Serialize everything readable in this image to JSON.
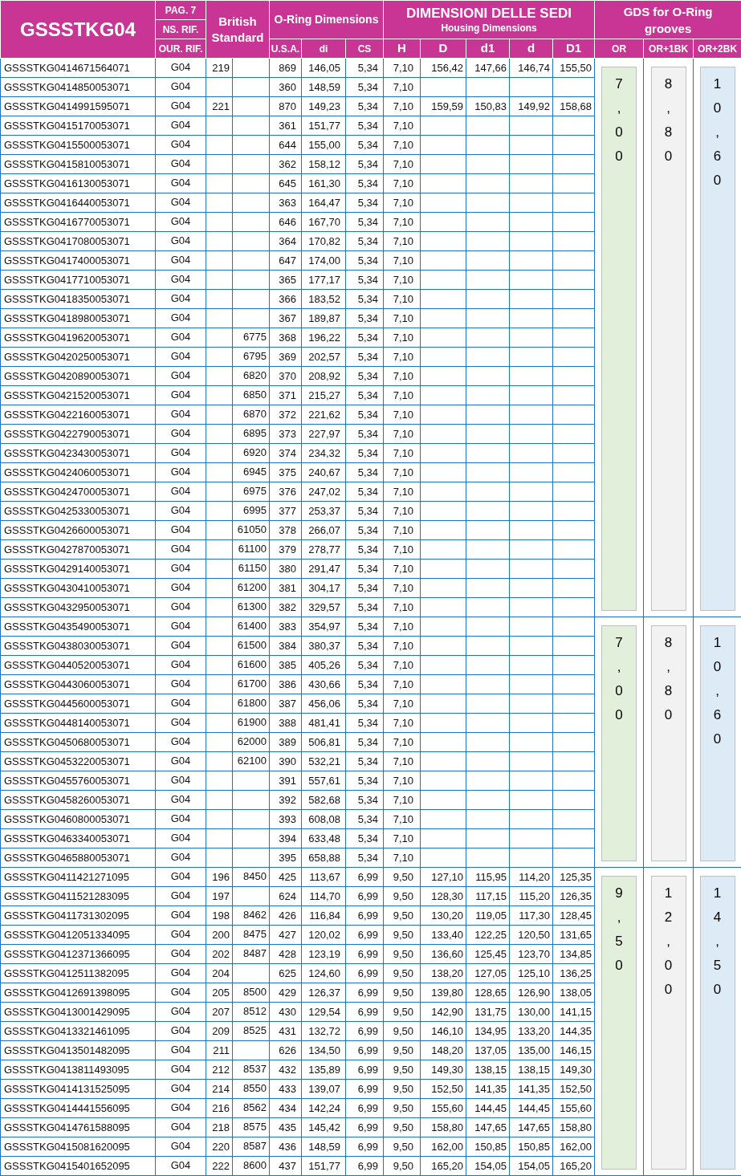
{
  "header": {
    "title": "GSSSTKG04",
    "page": "PAG. 7",
    "ns_ref": "NS. RIF.",
    "our_ref": "OUR. RIF.",
    "british_standard": "British Standard",
    "oring_dimensions": {
      "title": "O-Ring Dimensions",
      "columns": [
        "U.S.A.",
        "di",
        "CS"
      ]
    },
    "housing": {
      "title": "DIMENSIONI DELLE SEDI",
      "subtitle": "Housing Dimensions",
      "columns": [
        "H",
        "D",
        "d1",
        "d",
        "D1"
      ]
    },
    "gds": {
      "title": "GDS for O-Ring grooves",
      "columns": [
        "OR",
        "OR+1BK",
        "OR+2BK"
      ]
    }
  },
  "groups": [
    {
      "or": "7,00",
      "or_1bk": "8,80",
      "or_2bk": "10,60",
      "rows": [
        {
          "code": "GSSSTKG0414671564071",
          "ref": "G04",
          "bs": "219",
          "usa": "869",
          "di": "146,05",
          "cs": "5,34",
          "H": "7,10",
          "D": "156,42",
          "d1": "147,66",
          "d": "146,74",
          "D1": "155,50"
        },
        {
          "code": "GSSSTKG0414850053071",
          "ref": "G04",
          "usa": "360",
          "di": "148,59",
          "cs": "5,34",
          "H": "7,10"
        },
        {
          "code": "GSSSTKG0414991595071",
          "ref": "G04",
          "bs": "221",
          "usa": "870",
          "di": "149,23",
          "cs": "5,34",
          "H": "7,10",
          "D": "159,59",
          "d1": "150,83",
          "d": "149,92",
          "D1": "158,68"
        },
        {
          "code": "GSSSTKG0415170053071",
          "ref": "G04",
          "usa": "361",
          "di": "151,77",
          "cs": "5,34",
          "H": "7,10"
        },
        {
          "code": "GSSSTKG0415500053071",
          "ref": "G04",
          "usa": "644",
          "di": "155,00",
          "cs": "5,34",
          "H": "7,10"
        },
        {
          "code": "GSSSTKG0415810053071",
          "ref": "G04",
          "usa": "362",
          "di": "158,12",
          "cs": "5,34",
          "H": "7,10"
        },
        {
          "code": "GSSSTKG0416130053071",
          "ref": "G04",
          "usa": "645",
          "di": "161,30",
          "cs": "5,34",
          "H": "7,10"
        },
        {
          "code": "GSSSTKG0416440053071",
          "ref": "G04",
          "usa": "363",
          "di": "164,47",
          "cs": "5,34",
          "H": "7,10"
        },
        {
          "code": "GSSSTKG0416770053071",
          "ref": "G04",
          "usa": "646",
          "di": "167,70",
          "cs": "5,34",
          "H": "7,10"
        },
        {
          "code": "GSSSTKG0417080053071",
          "ref": "G04",
          "usa": "364",
          "di": "170,82",
          "cs": "5,34",
          "H": "7,10"
        },
        {
          "code": "GSSSTKG0417400053071",
          "ref": "G04",
          "usa": "647",
          "di": "174,00",
          "cs": "5,34",
          "H": "7,10"
        },
        {
          "code": "GSSSTKG0417710053071",
          "ref": "G04",
          "usa": "365",
          "di": "177,17",
          "cs": "5,34",
          "H": "7,10"
        },
        {
          "code": "GSSSTKG0418350053071",
          "ref": "G04",
          "usa": "366",
          "di": "183,52",
          "cs": "5,34",
          "H": "7,10"
        },
        {
          "code": "GSSSTKG0418980053071",
          "ref": "G04",
          "usa": "367",
          "di": "189,87",
          "cs": "5,34",
          "H": "7,10"
        },
        {
          "code": "GSSSTKG0419620053071",
          "ref": "G04",
          "bs2": "6775",
          "usa": "368",
          "di": "196,22",
          "cs": "5,34",
          "H": "7,10"
        },
        {
          "code": "GSSSTKG0420250053071",
          "ref": "G04",
          "bs2": "6795",
          "usa": "369",
          "di": "202,57",
          "cs": "5,34",
          "H": "7,10"
        },
        {
          "code": "GSSSTKG0420890053071",
          "ref": "G04",
          "bs2": "6820",
          "usa": "370",
          "di": "208,92",
          "cs": "5,34",
          "H": "7,10"
        },
        {
          "code": "GSSSTKG0421520053071",
          "ref": "G04",
          "bs2": "6850",
          "usa": "371",
          "di": "215,27",
          "cs": "5,34",
          "H": "7,10"
        },
        {
          "code": "GSSSTKG0422160053071",
          "ref": "G04",
          "bs2": "6870",
          "usa": "372",
          "di": "221,62",
          "cs": "5,34",
          "H": "7,10"
        },
        {
          "code": "GSSSTKG0422790053071",
          "ref": "G04",
          "bs2": "6895",
          "usa": "373",
          "di": "227,97",
          "cs": "5,34",
          "H": "7,10"
        },
        {
          "code": "GSSSTKG0423430053071",
          "ref": "G04",
          "bs2": "6920",
          "usa": "374",
          "di": "234,32",
          "cs": "5,34",
          "H": "7,10"
        },
        {
          "code": "GSSSTKG0424060053071",
          "ref": "G04",
          "bs2": "6945",
          "usa": "375",
          "di": "240,67",
          "cs": "5,34",
          "H": "7,10"
        },
        {
          "code": "GSSSTKG0424700053071",
          "ref": "G04",
          "bs2": "6975",
          "usa": "376",
          "di": "247,02",
          "cs": "5,34",
          "H": "7,10"
        },
        {
          "code": "GSSSTKG0425330053071",
          "ref": "G04",
          "bs2": "6995",
          "usa": "377",
          "di": "253,37",
          "cs": "5,34",
          "H": "7,10"
        },
        {
          "code": "GSSSTKG0426600053071",
          "ref": "G04",
          "bs2": "61050",
          "usa": "378",
          "di": "266,07",
          "cs": "5,34",
          "H": "7,10"
        },
        {
          "code": "GSSSTKG0427870053071",
          "ref": "G04",
          "bs2": "61100",
          "usa": "379",
          "di": "278,77",
          "cs": "5,34",
          "H": "7,10"
        },
        {
          "code": "GSSSTKG0429140053071",
          "ref": "G04",
          "bs2": "61150",
          "usa": "380",
          "di": "291,47",
          "cs": "5,34",
          "H": "7,10"
        },
        {
          "code": "GSSSTKG0430410053071",
          "ref": "G04",
          "bs2": "61200",
          "usa": "381",
          "di": "304,17",
          "cs": "5,34",
          "H": "7,10"
        },
        {
          "code": "GSSSTKG0432950053071",
          "ref": "G04",
          "bs2": "61300",
          "usa": "382",
          "di": "329,57",
          "cs": "5,34",
          "H": "7,10"
        }
      ]
    },
    {
      "or": "7,00",
      "or_1bk": "8,80",
      "or_2bk": "10,60",
      "rows": [
        {
          "code": "GSSSTKG0435490053071",
          "ref": "G04",
          "bs2": "61400",
          "usa": "383",
          "di": "354,97",
          "cs": "5,34",
          "H": "7,10"
        },
        {
          "code": "GSSSTKG0438030053071",
          "ref": "G04",
          "bs2": "61500",
          "usa": "384",
          "di": "380,37",
          "cs": "5,34",
          "H": "7,10"
        },
        {
          "code": "GSSSTKG0440520053071",
          "ref": "G04",
          "bs2": "61600",
          "usa": "385",
          "di": "405,26",
          "cs": "5,34",
          "H": "7,10"
        },
        {
          "code": "GSSSTKG0443060053071",
          "ref": "G04",
          "bs2": "61700",
          "usa": "386",
          "di": "430,66",
          "cs": "5,34",
          "H": "7,10"
        },
        {
          "code": "GSSSTKG0445600053071",
          "ref": "G04",
          "bs2": "61800",
          "usa": "387",
          "di": "456,06",
          "cs": "5,34",
          "H": "7,10"
        },
        {
          "code": "GSSSTKG0448140053071",
          "ref": "G04",
          "bs2": "61900",
          "usa": "388",
          "di": "481,41",
          "cs": "5,34",
          "H": "7,10"
        },
        {
          "code": "GSSSTKG0450680053071",
          "ref": "G04",
          "bs2": "62000",
          "usa": "389",
          "di": "506,81",
          "cs": "5,34",
          "H": "7,10"
        },
        {
          "code": "GSSSTKG0453220053071",
          "ref": "G04",
          "bs2": "62100",
          "usa": "390",
          "di": "532,21",
          "cs": "5,34",
          "H": "7,10"
        },
        {
          "code": "GSSSTKG0455760053071",
          "ref": "G04",
          "usa": "391",
          "di": "557,61",
          "cs": "5,34",
          "H": "7,10"
        },
        {
          "code": "GSSSTKG0458260053071",
          "ref": "G04",
          "usa": "392",
          "di": "582,68",
          "cs": "5,34",
          "H": "7,10"
        },
        {
          "code": "GSSSTKG0460800053071",
          "ref": "G04",
          "usa": "393",
          "di": "608,08",
          "cs": "5,34",
          "H": "7,10"
        },
        {
          "code": "GSSSTKG0463340053071",
          "ref": "G04",
          "usa": "394",
          "di": "633,48",
          "cs": "5,34",
          "H": "7,10"
        },
        {
          "code": "GSSSTKG0465880053071",
          "ref": "G04",
          "usa": "395",
          "di": "658,88",
          "cs": "5,34",
          "H": "7,10"
        }
      ]
    },
    {
      "or": "9,50",
      "or_1bk": "12,00",
      "or_2bk": "14,50",
      "rows": [
        {
          "code": "GSSSTKG0411421271095",
          "ref": "G04",
          "bs": "196",
          "bs2": "8450",
          "usa": "425",
          "di": "113,67",
          "cs": "6,99",
          "H": "9,50",
          "D": "127,10",
          "d1": "115,95",
          "d": "114,20",
          "D1": "125,35"
        },
        {
          "code": "GSSSTKG0411521283095",
          "ref": "G04",
          "bs": "197",
          "usa": "624",
          "di": "114,70",
          "cs": "6,99",
          "H": "9,50",
          "D": "128,30",
          "d1": "117,15",
          "d": "115,20",
          "D1": "126,35"
        },
        {
          "code": "GSSSTKG0411731302095",
          "ref": "G04",
          "bs": "198",
          "bs2": "8462",
          "usa": "426",
          "di": "116,84",
          "cs": "6,99",
          "H": "9,50",
          "D": "130,20",
          "d1": "119,05",
          "d": "117,30",
          "D1": "128,45"
        },
        {
          "code": "GSSSTKG0412051334095",
          "ref": "G04",
          "bs": "200",
          "bs2": "8475",
          "usa": "427",
          "di": "120,02",
          "cs": "6,99",
          "H": "9,50",
          "D": "133,40",
          "d1": "122,25",
          "d": "120,50",
          "D1": "131,65"
        },
        {
          "code": "GSSSTKG0412371366095",
          "ref": "G04",
          "bs": "202",
          "bs2": "8487",
          "usa": "428",
          "di": "123,19",
          "cs": "6,99",
          "H": "9,50",
          "D": "136,60",
          "d1": "125,45",
          "d": "123,70",
          "D1": "134,85"
        },
        {
          "code": "GSSSTKG0412511382095",
          "ref": "G04",
          "bs": "204",
          "usa": "625",
          "di": "124,60",
          "cs": "6,99",
          "H": "9,50",
          "D": "138,20",
          "d1": "127,05",
          "d": "125,10",
          "D1": "136,25"
        },
        {
          "code": "GSSSTKG0412691398095",
          "ref": "G04",
          "bs": "205",
          "bs2": "8500",
          "usa": "429",
          "di": "126,37",
          "cs": "6,99",
          "H": "9,50",
          "D": "139,80",
          "d1": "128,65",
          "d": "126,90",
          "D1": "138,05"
        },
        {
          "code": "GSSSTKG0413001429095",
          "ref": "G04",
          "bs": "207",
          "bs2": "8512",
          "usa": "430",
          "di": "129,54",
          "cs": "6,99",
          "H": "9,50",
          "D": "142,90",
          "d1": "131,75",
          "d": "130,00",
          "D1": "141,15"
        },
        {
          "code": "GSSSTKG0413321461095",
          "ref": "G04",
          "bs": "209",
          "bs2": "8525",
          "usa": "431",
          "di": "132,72",
          "cs": "6,99",
          "H": "9,50",
          "D": "146,10",
          "d1": "134,95",
          "d": "133,20",
          "D1": "144,35"
        },
        {
          "code": "GSSSTKG0413501482095",
          "ref": "G04",
          "bs": "211",
          "usa": "626",
          "di": "134,50",
          "cs": "6,99",
          "H": "9,50",
          "D": "148,20",
          "d1": "137,05",
          "d": "135,00",
          "D1": "146,15"
        },
        {
          "code": "GSSSTKG0413811493095",
          "ref": "G04",
          "bs": "212",
          "bs2": "8537",
          "usa": "432",
          "di": "135,89",
          "cs": "6,99",
          "H": "9,50",
          "D": "149,30",
          "d1": "138,15",
          "d": "138,15",
          "D1": "149,30"
        },
        {
          "code": "GSSSTKG0414131525095",
          "ref": "G04",
          "bs": "214",
          "bs2": "8550",
          "usa": "433",
          "di": "139,07",
          "cs": "6,99",
          "H": "9,50",
          "D": "152,50",
          "d1": "141,35",
          "d": "141,35",
          "D1": "152,50"
        },
        {
          "code": "GSSSTKG0414441556095",
          "ref": "G04",
          "bs": "216",
          "bs2": "8562",
          "usa": "434",
          "di": "142,24",
          "cs": "6,99",
          "H": "9,50",
          "D": "155,60",
          "d1": "144,45",
          "d": "144,45",
          "D1": "155,60"
        },
        {
          "code": "GSSSTKG0414761588095",
          "ref": "G04",
          "bs": "218",
          "bs2": "8575",
          "usa": "435",
          "di": "145,42",
          "cs": "6,99",
          "H": "9,50",
          "D": "158,80",
          "d1": "147,65",
          "d": "147,65",
          "D1": "158,80"
        },
        {
          "code": "GSSSTKG0415081620095",
          "ref": "G04",
          "bs": "220",
          "bs2": "8587",
          "usa": "436",
          "di": "148,59",
          "cs": "6,99",
          "H": "9,50",
          "D": "162,00",
          "d1": "150,85",
          "d": "150,85",
          "D1": "162,00"
        },
        {
          "code": "GSSSTKG0415401652095",
          "ref": "G04",
          "bs": "222",
          "bs2": "8600",
          "usa": "437",
          "di": "151,77",
          "cs": "6,99",
          "H": "9,50",
          "D": "165,20",
          "d1": "154,05",
          "d": "154,05",
          "D1": "165,20"
        }
      ]
    }
  ]
}
